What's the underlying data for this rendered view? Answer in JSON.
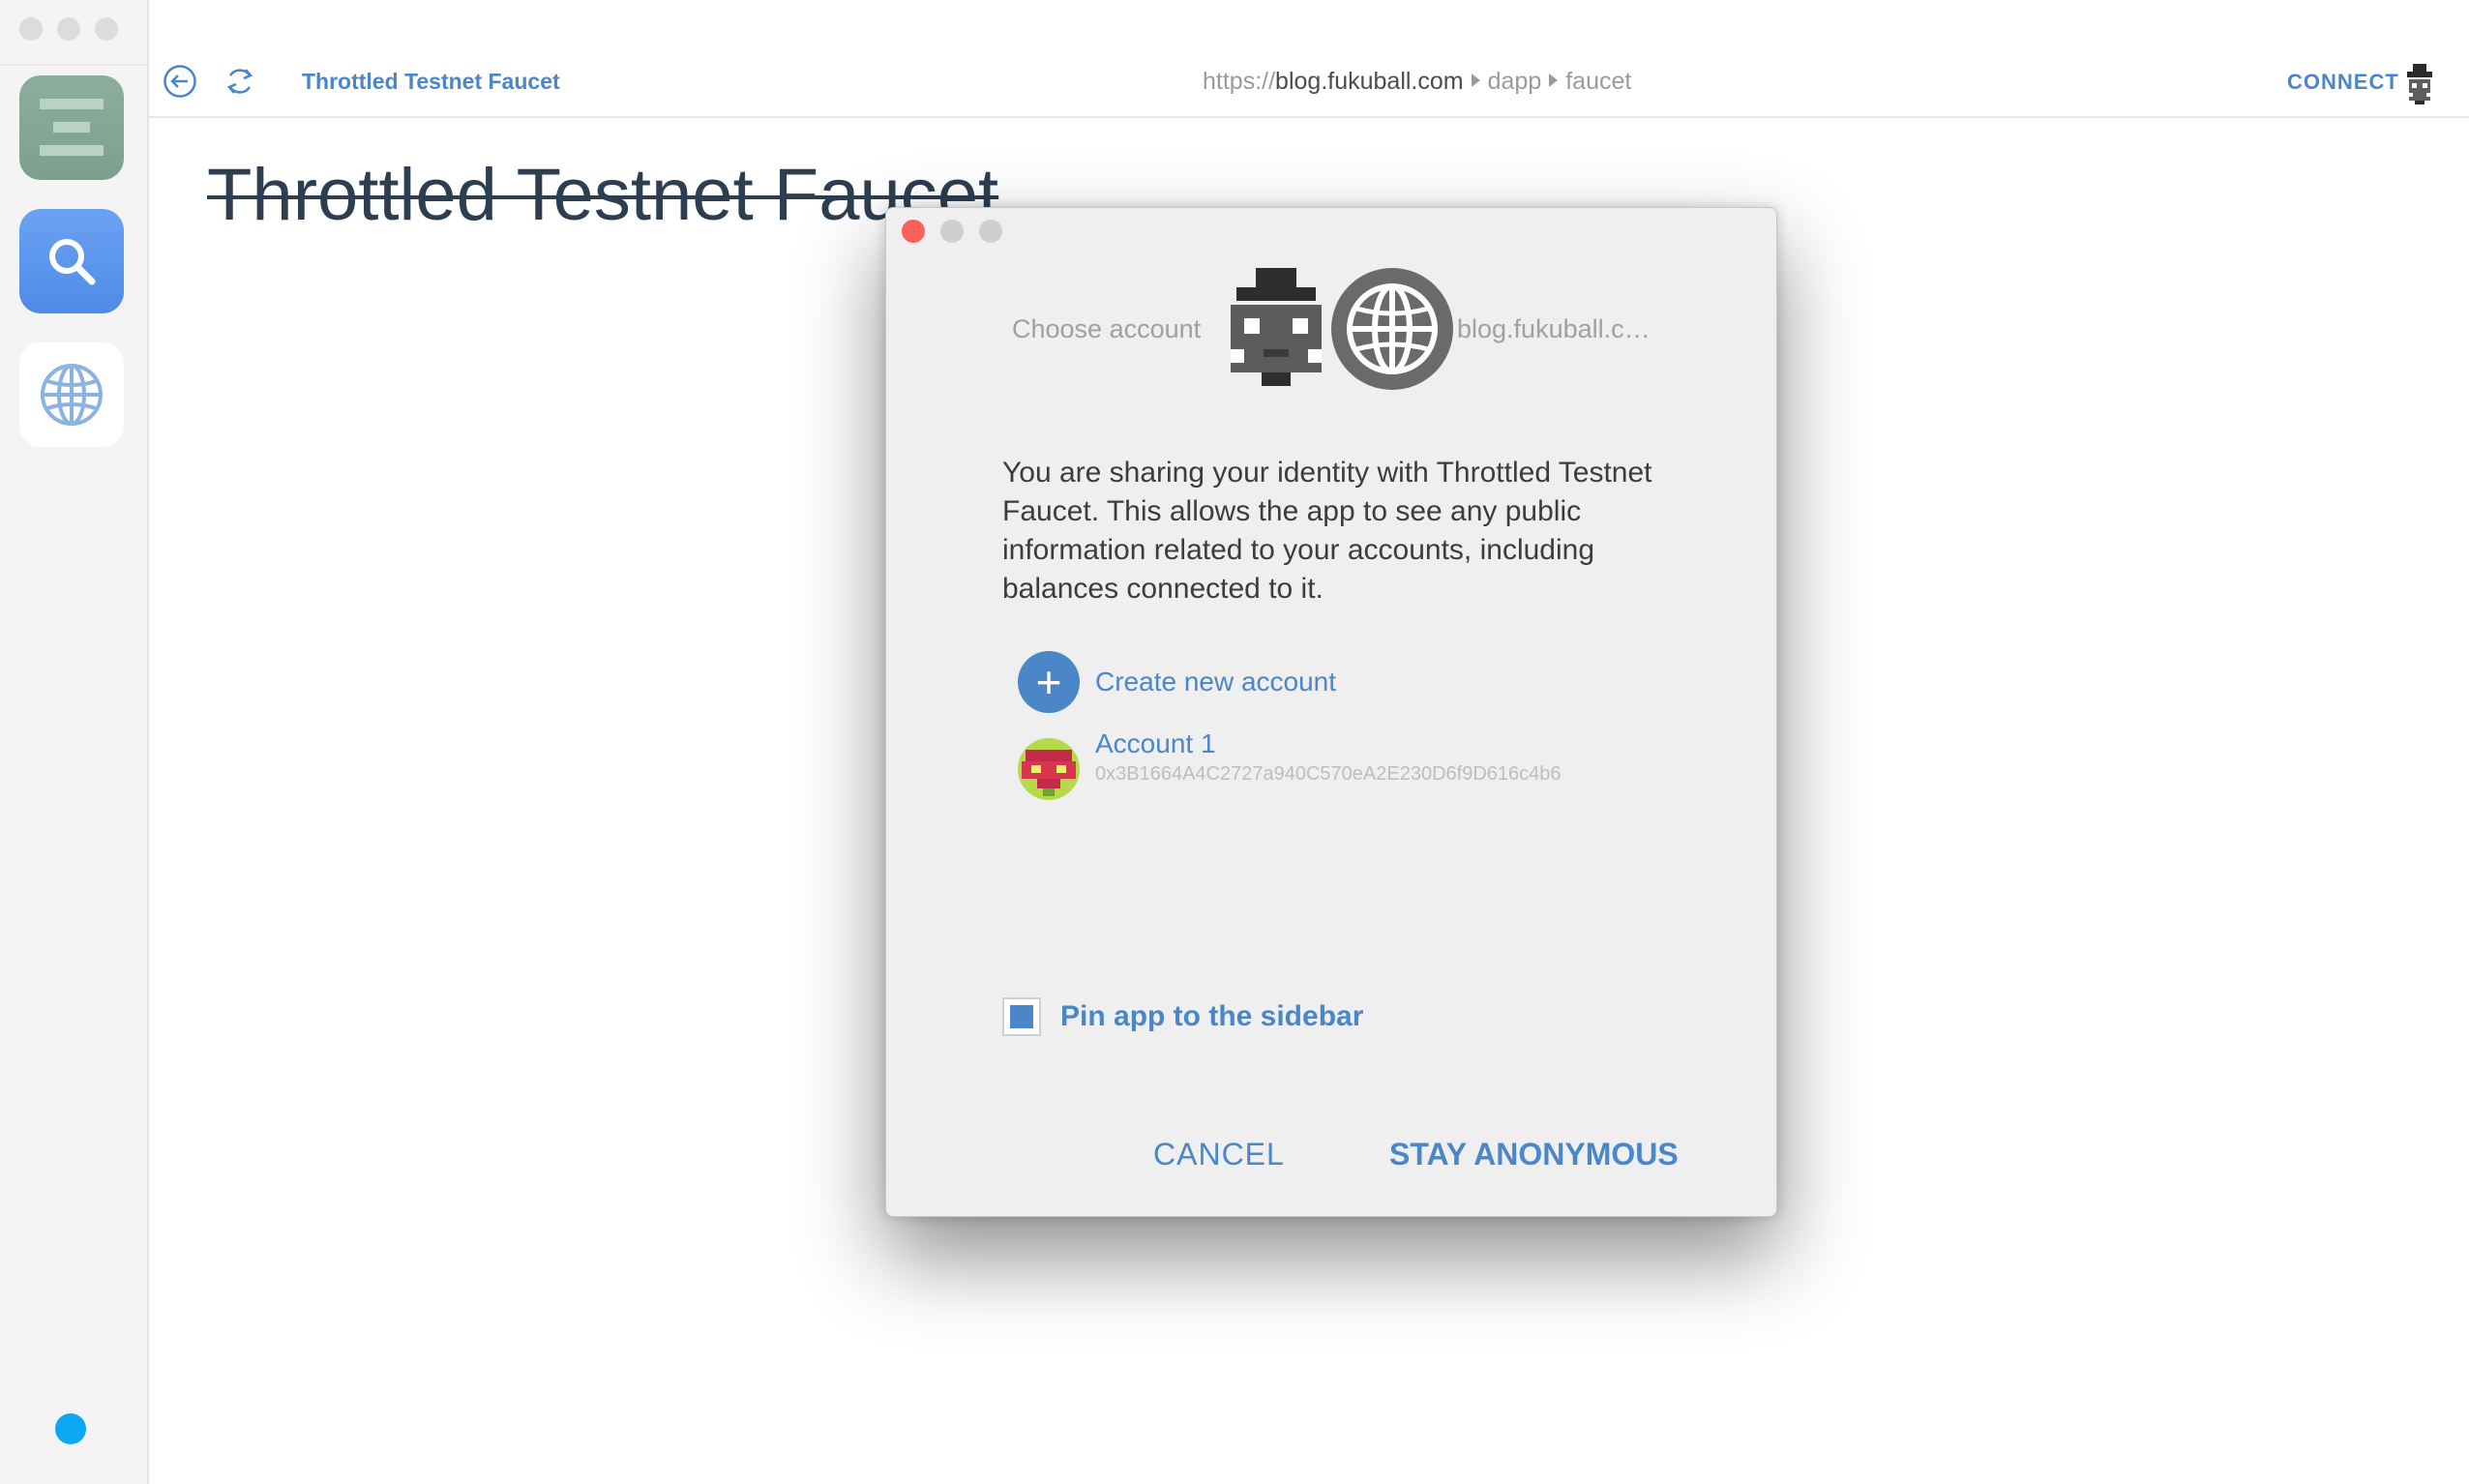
{
  "sidebar": {
    "apps": [
      {
        "name": "mist-wallet-icon"
      },
      {
        "name": "search-icon"
      },
      {
        "name": "globe-icon"
      }
    ],
    "status_color": "#0ba8f4"
  },
  "toolbar": {
    "tab_title": "Throttled Testnet Faucet",
    "url_scheme": "https://",
    "url_host": "blog.fukuball.com",
    "url_path": [
      "dapp",
      "faucet"
    ],
    "connect_label": "CONNECT"
  },
  "page": {
    "title": "Throttled Testnet Faucet"
  },
  "modal": {
    "choose_account_label": "Choose account",
    "site_host": "blog.fukuball.c…",
    "description": "You are sharing your identity with Throttled Testnet Faucet. This allows the app to see any public information related to your accounts, including balances connected to it.",
    "create_account_label": "Create new account",
    "accounts": [
      {
        "name": "Account 1",
        "address": "0x3B1664A4C2727a940C570eA2E230D6f9D616c4b6"
      }
    ],
    "pin_label": "Pin app to the sidebar",
    "pin_checked": true,
    "cancel_label": "CANCEL",
    "stay_anonymous_label": "STAY ANONYMOUS"
  },
  "colors": {
    "accent": "#4a86c8",
    "close_button": "#fc605c"
  }
}
